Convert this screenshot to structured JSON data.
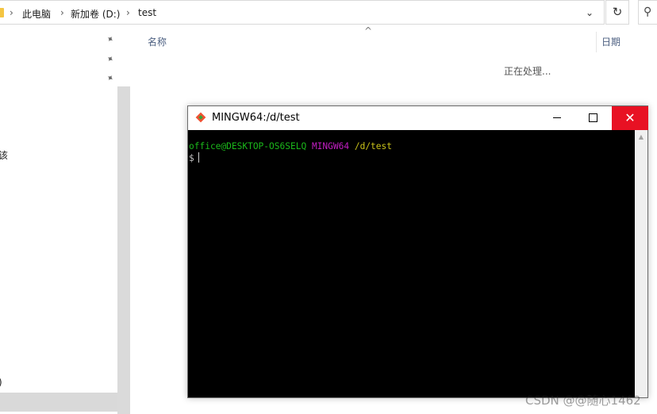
{
  "explorer": {
    "breadcrumb": [
      "此电脑",
      "新加卷 (D:)",
      "test"
    ],
    "separator": "›",
    "dropdown_glyph": "⌄",
    "refresh_glyph": "↻",
    "search_glyph": "⚲",
    "pin_glyph": "📌",
    "nav_fragments": [
      "该",
      ")"
    ],
    "columns": {
      "name": "名称",
      "date": "日期"
    },
    "sort_glyph": "^",
    "status_text": "正在处理..."
  },
  "terminal": {
    "title": "MINGW64:/d/test",
    "close_glyph": "✕",
    "scroll_up_glyph": "▲",
    "prompt": {
      "user_host": "office@DESKTOP-OS6SELQ",
      "env": "MINGW64",
      "path": "/d/test",
      "symbol": "$"
    },
    "colors": {
      "close": "#e81123",
      "user_host": "#1bb81b",
      "env": "#c31ec3",
      "path": "#c9c21a"
    }
  },
  "watermark": "CSDN @@随心1462"
}
